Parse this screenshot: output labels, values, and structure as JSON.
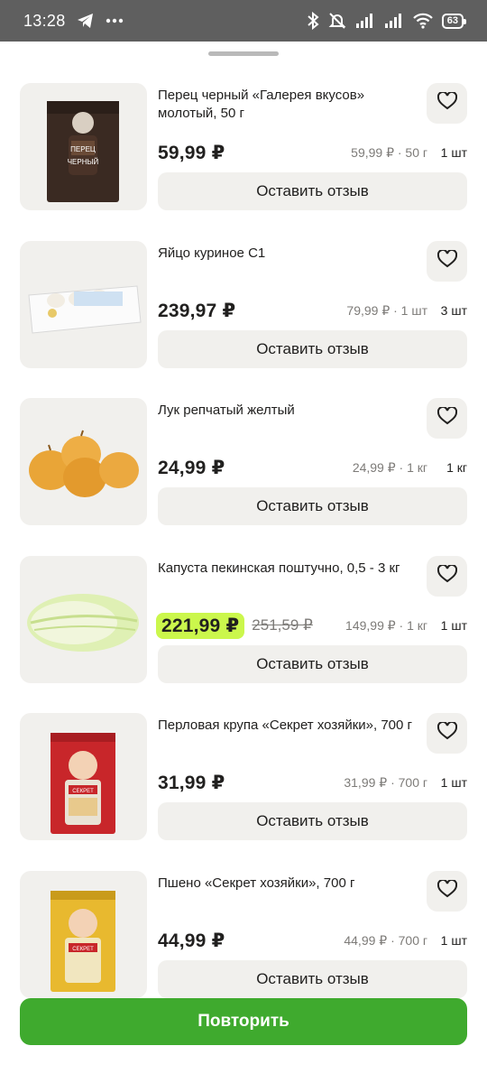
{
  "status_bar": {
    "time": "13:28",
    "battery": "63"
  },
  "items": [
    {
      "title": "Перец черный «Галерея вкусов» молотый, 50 г",
      "price": "59,99 ₽",
      "old_price": "",
      "unit_price": "59,99 ₽ · 50 г",
      "qty": "1 шт",
      "review_label": "Оставить отзыв",
      "image": "pepper-pack"
    },
    {
      "title": "Яйцо куриное С1",
      "price": "239,97 ₽",
      "old_price": "",
      "unit_price": "79,99 ₽ · 1 шт",
      "qty": "3 шт",
      "review_label": "Оставить отзыв",
      "image": "egg-carton"
    },
    {
      "title": "Лук репчатый желтый",
      "price": "24,99 ₽",
      "old_price": "",
      "unit_price": "24,99 ₽ · 1 кг",
      "qty": "1 кг",
      "review_label": "Оставить отзыв",
      "image": "onions"
    },
    {
      "title": "Капуста пекинская поштучно, 0,5 - 3 кг",
      "price": "221,99 ₽",
      "old_price": "251,59 ₽",
      "unit_price": "149,99 ₽ · 1 кг",
      "qty": "1 шт",
      "review_label": "Оставить отзыв",
      "image": "napa-cabbage",
      "promo": true
    },
    {
      "title": "Перловая крупа «Секрет хозяйки», 700 г",
      "price": "31,99 ₽",
      "old_price": "",
      "unit_price": "31,99 ₽ · 700 г",
      "qty": "1 шт",
      "review_label": "Оставить отзыв",
      "image": "barley-pack"
    },
    {
      "title": "Пшено «Секрет хозяйки», 700 г",
      "price": "44,99 ₽",
      "old_price": "",
      "unit_price": "44,99 ₽ · 700 г",
      "qty": "1 шт",
      "review_label": "Оставить отзыв",
      "image": "millet-pack"
    }
  ],
  "repeat_button": {
    "label": "Повторить"
  },
  "colors": {
    "accent_green": "#3faa2e",
    "promo_highlight": "#cbf74c"
  },
  "icons": [
    "telegram-icon",
    "more-icon",
    "bluetooth-icon",
    "bell-muted-icon",
    "signal-icon",
    "wifi-icon",
    "battery-icon",
    "heart-icon"
  ]
}
